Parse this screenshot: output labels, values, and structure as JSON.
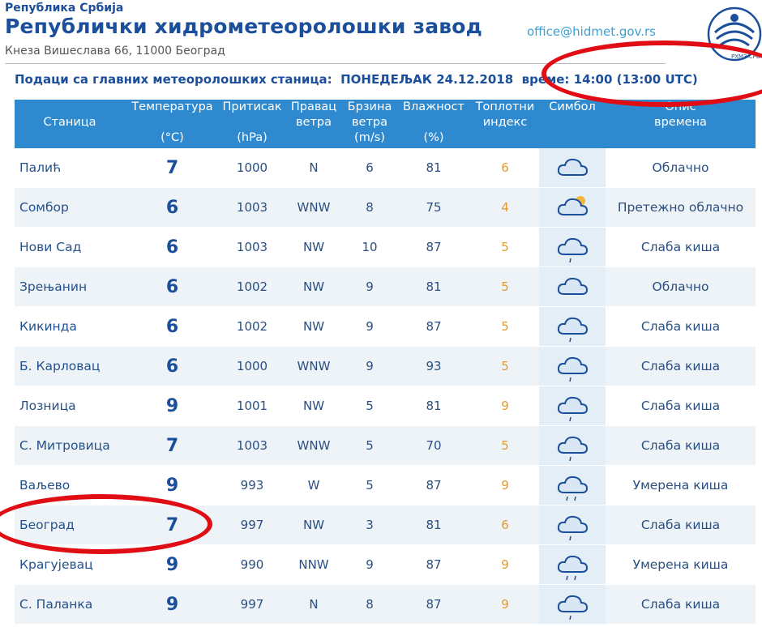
{
  "header": {
    "republic": "Република Србија",
    "title": "Републички хидрометеоролошки завод",
    "address": "Кнеза Вишеслава 66, 11000 Београд",
    "email": "office@hidmet.gov.rs",
    "logo_text": "РХМЗ СРБ"
  },
  "info": {
    "label": "Подаци са главних метеоролошких станица:",
    "date": "ПОНЕДЕЉАК 24.12.2018",
    "time": "време: 14:00 (13:00 UTC)"
  },
  "table": {
    "headers": {
      "station": "Станица",
      "temp": "Температура",
      "temp_unit": "(°C)",
      "pressure": "Притисак",
      "pressure_unit": "(hPa)",
      "wind_dir_1": "Правац",
      "wind_dir_2": "ветра",
      "wind_speed_1": "Брзина",
      "wind_speed_2": "ветра",
      "wind_speed_unit": "(m/s)",
      "humidity": "Влажност",
      "humidity_unit": "(%)",
      "heat_1": "Топлотни",
      "heat_2": "индекс",
      "symbol": "Симбол",
      "desc_1": "Опис",
      "desc_2": "времена"
    },
    "rows": [
      {
        "station": "Палић",
        "temp": "7",
        "pressure": "1000",
        "dir": "N",
        "speed": "6",
        "humidity": "81",
        "heat": "6",
        "icon": "cloud-icon",
        "desc": "Облачно"
      },
      {
        "station": "Сомбор",
        "temp": "6",
        "pressure": "1003",
        "dir": "WNW",
        "speed": "8",
        "humidity": "75",
        "heat": "4",
        "icon": "partly-cloudy-icon",
        "desc": "Претежно облачно"
      },
      {
        "station": "Нови Сад",
        "temp": "6",
        "pressure": "1003",
        "dir": "NW",
        "speed": "10",
        "humidity": "87",
        "heat": "5",
        "icon": "light-rain-icon",
        "desc": "Слаба киша"
      },
      {
        "station": "Зрењанин",
        "temp": "6",
        "pressure": "1002",
        "dir": "NW",
        "speed": "9",
        "humidity": "81",
        "heat": "5",
        "icon": "cloud-icon",
        "desc": "Облачно"
      },
      {
        "station": "Кикинда",
        "temp": "6",
        "pressure": "1002",
        "dir": "NW",
        "speed": "9",
        "humidity": "87",
        "heat": "5",
        "icon": "light-rain-icon",
        "desc": "Слаба киша"
      },
      {
        "station": "Б. Карловац",
        "temp": "6",
        "pressure": "1000",
        "dir": "WNW",
        "speed": "9",
        "humidity": "93",
        "heat": "5",
        "icon": "light-rain-icon",
        "desc": "Слаба киша"
      },
      {
        "station": "Лозница",
        "temp": "9",
        "pressure": "1001",
        "dir": "NW",
        "speed": "5",
        "humidity": "81",
        "heat": "9",
        "icon": "light-rain-icon",
        "desc": "Слаба киша"
      },
      {
        "station": "С. Митровица",
        "temp": "7",
        "pressure": "1003",
        "dir": "WNW",
        "speed": "5",
        "humidity": "70",
        "heat": "5",
        "icon": "light-rain-icon",
        "desc": "Слаба киша"
      },
      {
        "station": "Ваљево",
        "temp": "9",
        "pressure": "993",
        "dir": "W",
        "speed": "5",
        "humidity": "87",
        "heat": "9",
        "icon": "moderate-rain-icon",
        "desc": "Умерена киша"
      },
      {
        "station": "Београд",
        "temp": "7",
        "pressure": "997",
        "dir": "NW",
        "speed": "3",
        "humidity": "81",
        "heat": "6",
        "icon": "light-rain-icon",
        "desc": "Слаба киша"
      },
      {
        "station": "Крагујевац",
        "temp": "9",
        "pressure": "990",
        "dir": "NNW",
        "speed": "9",
        "humidity": "87",
        "heat": "9",
        "icon": "moderate-rain-icon",
        "desc": "Умерена киша"
      },
      {
        "station": "С. Паланка",
        "temp": "9",
        "pressure": "997",
        "dir": "N",
        "speed": "8",
        "humidity": "87",
        "heat": "9",
        "icon": "light-rain-icon",
        "desc": "Слаба киша"
      }
    ]
  },
  "colors": {
    "brand": "#1b4f9c",
    "header_bg": "#2f89cf",
    "heat_index": "#e39a2e",
    "annotation_ring": "#e00d14"
  }
}
